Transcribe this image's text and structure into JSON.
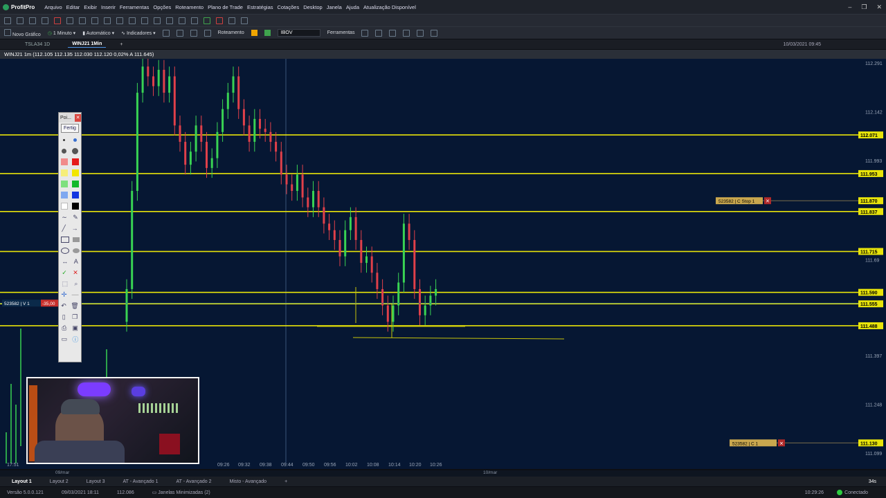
{
  "app": {
    "name": "ProfitPro"
  },
  "menu": [
    "Arquivo",
    "Editar",
    "Exibir",
    "Inserir",
    "Ferramentas",
    "Opções",
    "Roteamento",
    "Plano de Trade",
    "Estratégias",
    "Cotações",
    "Desktop",
    "Janela",
    "Ajuda",
    "Atualização Disponível"
  ],
  "toolbar": {
    "new_chart": "Novo Gráfico",
    "interval": "1 Minuto",
    "mode": "Automático",
    "indicators": "Indicadores",
    "routing": "Roteamento",
    "symbol_select": "IBOV",
    "tools": "Ferramentas"
  },
  "tabs": [
    {
      "label": "TSLA34 1D",
      "active": false
    },
    {
      "label": "WINJ21 1Min",
      "active": true
    }
  ],
  "tab_date": "10/03/2021 09:45",
  "chart_header": "WINJ21 1m (112.105  112.135  112.030  112.120  0,02%  A 111.645)",
  "chart_data": {
    "type": "candlestick",
    "symbol": "WINJ21",
    "timeframe": "1m",
    "price_axis_ticks": [
      "112.291",
      "112.142",
      "111.993",
      "111.69",
      "111.397",
      "111.248",
      "111.099"
    ],
    "horizontal_levels": [
      "112.071",
      "111.953",
      "111.837",
      "111.715",
      "111.590",
      "111.555",
      "111.488"
    ],
    "time_ticks": [
      "17:51",
      "09:26",
      "09:32",
      "09:38",
      "09:44",
      "09:50",
      "09:56",
      "10:02",
      "10:08",
      "10:14",
      "10:20",
      "10:26"
    ],
    "date_labels": [
      "09/mar",
      "10/mar"
    ],
    "order_labels": [
      {
        "text": "523582 | C Stop 1",
        "price": "111.870"
      },
      {
        "text": "523582 | C 1",
        "price": "111.130"
      }
    ],
    "position": {
      "text": "523582 | V 1",
      "pnl": "-35,00"
    },
    "colors": {
      "background": "#061733",
      "up": "#39d353",
      "down": "#e0404a",
      "level": "#e8e40a"
    }
  },
  "palette": {
    "title": "Poi...",
    "done": "Fertig"
  },
  "bottom_tabs": [
    "Layout 1",
    "Layout 2",
    "Layout 3",
    "AT - Avançado 1",
    "AT - Avançado 2",
    "Misto - Avançado"
  ],
  "timer": "34s",
  "status": {
    "version": "Versão 5.0.0.121",
    "datetime": "09/03/2021 18:11",
    "price": "112.086",
    "minimized": "Janelas Minimizadas (2)",
    "clock": "10:29:26",
    "connection": "Conectado"
  }
}
